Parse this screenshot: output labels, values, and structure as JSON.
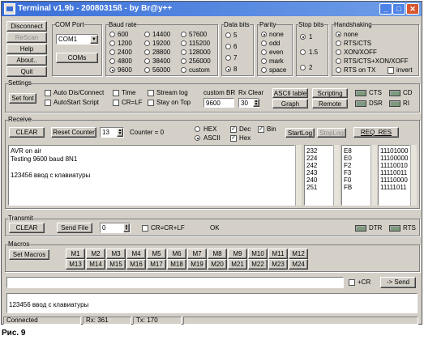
{
  "window": {
    "title": "Terminal v1.9b - 20080315ß - by Br@y++",
    "minimize": "_",
    "maximize": "□",
    "close": "✕"
  },
  "left_buttons": {
    "disconnect": "Disconnect",
    "rescan": "ReScan",
    "help": "Help",
    "about": "About..",
    "quit": "Quit"
  },
  "com_port": {
    "label": "COM Port",
    "value": "COM1",
    "coms_button": "COMs"
  },
  "baud_rate": {
    "label": "Baud rate",
    "options": [
      "600",
      "1200",
      "2400",
      "4800",
      "9600",
      "14400",
      "19200",
      "28800",
      "38400",
      "56000",
      "57600",
      "115200",
      "128000",
      "256000",
      "custom"
    ],
    "selected": "9600"
  },
  "data_bits": {
    "label": "Data bits",
    "options": [
      "5",
      "6",
      "7",
      "8"
    ],
    "selected": "8"
  },
  "parity": {
    "label": "Parity",
    "options": [
      "none",
      "odd",
      "even",
      "mark",
      "space"
    ],
    "selected": "none"
  },
  "stop_bits": {
    "label": "Stop bits",
    "options": [
      "1",
      "1.5",
      "2"
    ],
    "selected": "1"
  },
  "handshaking": {
    "label": "Handshaking",
    "options": [
      "none",
      "RTS/CTS",
      "XON/XOFF",
      "RTS/CTS+XON/XOFF",
      "RTS on TX"
    ],
    "selected": "none",
    "invert": "invert"
  },
  "settings": {
    "label": "Settings",
    "set_font": "Set font",
    "auto_dis_connect": "Auto Dis/Connect",
    "autostart_script": "AutoStart Script",
    "time": "Time",
    "cr_lf": "CR=LF",
    "stream_log": "Stream log",
    "stay_on_top": "Stay on Top",
    "custom_br_label": "custom BR",
    "custom_br_value": "9600",
    "rx_clear_label": "Rx Clear",
    "rx_clear_value": "30",
    "ascii_table": "ASCII table",
    "graph": "Graph",
    "scripting": "Scripting",
    "remote": "Remote",
    "leds": [
      "CTS",
      "CD",
      "DSR",
      "RI"
    ]
  },
  "receive": {
    "label": "Receive",
    "clear": "CLEAR",
    "reset_counter": "Reset Counter",
    "counter_spin": "13",
    "counter_text": "Counter = 0",
    "hex": "HEX",
    "ascii": "ASCII",
    "dec": "Dec",
    "hex_chk": "Hex",
    "bin": "Bin",
    "startlog": "StartLog",
    "stoplog": "StopLog",
    "req_res": "REQ_RES",
    "text_lines": [
      "AVR on air",
      "Testing 9600 baud 8N1",
      "",
      "123456 ввод с клавиатуры"
    ],
    "dec_values": [
      "232",
      "224",
      "242",
      "243",
      "240",
      "251"
    ],
    "hex_values": [
      "E8",
      "E0",
      "F2",
      "F3",
      "F0",
      "FB"
    ],
    "bin_values": [
      "11101000",
      "11100000",
      "11110010",
      "11110011",
      "11110000",
      "11111011"
    ]
  },
  "transmit": {
    "label": "Transmit",
    "clear": "CLEAR",
    "send_file": "Send File",
    "spin": "0",
    "cr_crlf": "CR=CR+LF",
    "status": "OK",
    "dtr": "DTR",
    "rts": "RTS"
  },
  "macros": {
    "label": "Macros",
    "set_macros": "Set Macros",
    "row1": [
      "M1",
      "M2",
      "M3",
      "M4",
      "M5",
      "M6",
      "M7",
      "M8",
      "M9",
      "M10",
      "M11",
      "M12"
    ],
    "row2": [
      "M13",
      "M14",
      "M15",
      "M16",
      "M17",
      "M18",
      "M19",
      "M20",
      "M21",
      "M22",
      "M23",
      "M24"
    ]
  },
  "send_line": {
    "value": "",
    "cr": "+CR",
    "send": "-> Send"
  },
  "history_line": "123456 ввод с клавиатуры",
  "status_bar": {
    "state": "Connected",
    "rx": "Rx: 361",
    "tx": "Tx: 170"
  },
  "caption": "Рис. 9"
}
